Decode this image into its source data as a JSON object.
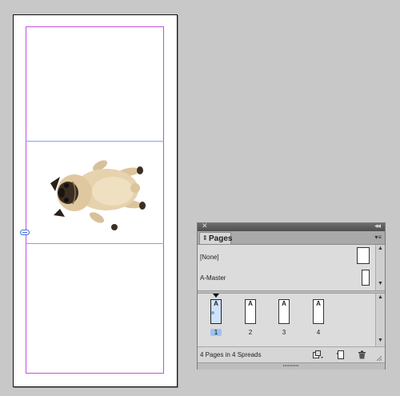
{
  "panel": {
    "tab_label": "Pages",
    "masters": [
      {
        "name": "[None]"
      },
      {
        "name": "A-Master"
      }
    ],
    "pages": [
      {
        "master": "A",
        "number": "1",
        "selected": true
      },
      {
        "master": "A",
        "number": "2",
        "selected": false
      },
      {
        "master": "A",
        "number": "3",
        "selected": false
      },
      {
        "master": "A",
        "number": "4",
        "selected": false
      }
    ],
    "status": "4 Pages in 4 Spreads"
  },
  "icons": {
    "close": "close-icon",
    "collapse": "double-chevron-left-icon",
    "panel_menu": "panel-menu-icon",
    "edit_page_size": "page-size-icon",
    "new_page": "new-page-icon",
    "delete_page": "trash-icon",
    "link": "link-badge-icon"
  },
  "colors": {
    "margin_guide": "#c050e0",
    "ruler_guide": "#6aaef0",
    "selection": "#9ec1ef"
  }
}
